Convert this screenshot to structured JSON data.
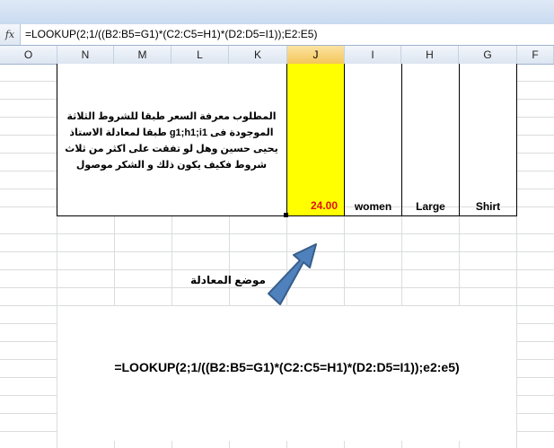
{
  "formula_bar": {
    "fx_label": "fx",
    "formula": "=LOOKUP(2;1/((B2:B5=G1)*(C2:C5=H1)*(D2:D5=I1));E2:E5)"
  },
  "column_headers": [
    "O",
    "N",
    "M",
    "L",
    "K",
    "J",
    "I",
    "H",
    "G",
    "F"
  ],
  "selected_column": "J",
  "cells": {
    "price": "24.00",
    "gender": "women",
    "size": "Large",
    "item": "Shirt",
    "question_text": "المطلوب معرفة السعر طبقا للشروط الثلاثة الموجودة فى g1;h1;i1 طبقا لمعادلة الاستاذ يحيى حسين وهل لو تفقت على اكثر من ثلاث شروط فكيف يكون ذلك و الشكر موصول"
  },
  "annotation": {
    "arrow_label": "موضع المعادلة",
    "formula_text": "=LOOKUP(2;1/((B2:B5=G1)*(C2:C5=H1)*(D2:D5=I1));e2:e5)"
  },
  "colors": {
    "highlight_cell": "#ffff00",
    "price_text": "#e01010",
    "arrow_fill": "#4f81bd",
    "arrow_stroke": "#385d8a",
    "gridline": "#dadcdd",
    "selected_header": "#f4c65a"
  },
  "icons": [
    "fx-icon",
    "up-right-arrow-icon"
  ]
}
